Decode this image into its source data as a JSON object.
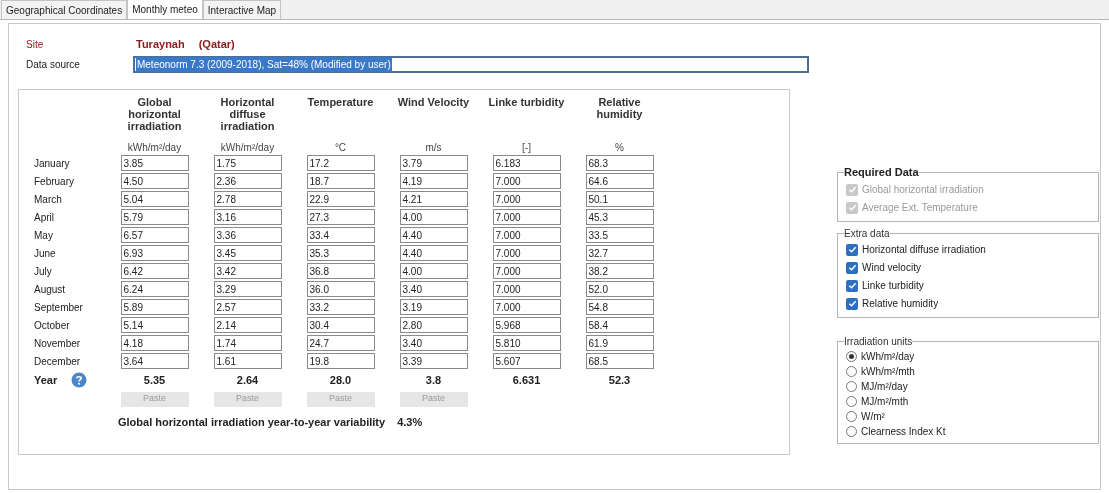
{
  "tabs": [
    {
      "label": "Geographical Coordinates",
      "selected": false
    },
    {
      "label": "Monthly meteo",
      "selected": true
    },
    {
      "label": "Interactive Map",
      "selected": false
    }
  ],
  "site": {
    "label": "Site",
    "name": "Turaynah",
    "country": "(Qatar)"
  },
  "data_source": {
    "label": "Data source",
    "value": "Meteonorm 7.3 (2009-2018), Sat=48% (Modified by user)"
  },
  "table": {
    "columns": [
      {
        "title": "Global horizontal irradiation",
        "unit": "kWh/m²/day",
        "year": "5.35",
        "paste": "Paste"
      },
      {
        "title": "Horizontal diffuse irradiation",
        "unit": "kWh/m²/day",
        "year": "2.64",
        "paste": "Paste"
      },
      {
        "title": "Temperature",
        "unit": "°C",
        "year": "28.0",
        "paste": "Paste"
      },
      {
        "title": "Wind Velocity",
        "unit": "m/s",
        "year": "3.8",
        "paste": "Paste"
      },
      {
        "title": "Linke turbidity",
        "unit": "[-]",
        "year": "6.631"
      },
      {
        "title": "Relative humidity",
        "unit": "%",
        "year": "52.3"
      }
    ],
    "rows": [
      {
        "month": "January",
        "values": [
          "3.85",
          "1.75",
          "17.2",
          "3.79",
          "6.183",
          "68.3"
        ]
      },
      {
        "month": "February",
        "values": [
          "4.50",
          "2.36",
          "18.7",
          "4.19",
          "7.000",
          "64.6"
        ]
      },
      {
        "month": "March",
        "values": [
          "5.04",
          "2.78",
          "22.9",
          "4.21",
          "7.000",
          "50.1"
        ]
      },
      {
        "month": "April",
        "values": [
          "5.79",
          "3.16",
          "27.3",
          "4.00",
          "7.000",
          "45.3"
        ]
      },
      {
        "month": "May",
        "values": [
          "6.57",
          "3.36",
          "33.4",
          "4.40",
          "7.000",
          "33.5"
        ]
      },
      {
        "month": "June",
        "values": [
          "6.93",
          "3.45",
          "35.3",
          "4.40",
          "7.000",
          "32.7"
        ]
      },
      {
        "month": "July",
        "values": [
          "6.42",
          "3.42",
          "36.8",
          "4.00",
          "7.000",
          "38.2"
        ]
      },
      {
        "month": "August",
        "values": [
          "6.24",
          "3.29",
          "36.0",
          "3.40",
          "7.000",
          "52.0"
        ]
      },
      {
        "month": "September",
        "values": [
          "5.89",
          "2.57",
          "33.2",
          "3.19",
          "7.000",
          "54.8"
        ]
      },
      {
        "month": "October",
        "values": [
          "5.14",
          "2.14",
          "30.4",
          "2.80",
          "5.968",
          "58.4"
        ]
      },
      {
        "month": "November",
        "values": [
          "4.18",
          "1.74",
          "24.7",
          "3.40",
          "5.810",
          "61.9"
        ]
      },
      {
        "month": "December",
        "values": [
          "3.64",
          "1.61",
          "19.8",
          "3.39",
          "5.607",
          "68.5"
        ]
      }
    ],
    "year_label": "Year",
    "variability": {
      "label": "Global horizontal irradiation year-to-year variability",
      "value": "4.3%"
    }
  },
  "required_data": {
    "title": "Required Data",
    "items": [
      {
        "label": "Global horizontal irradiation",
        "checked": true,
        "disabled": true
      },
      {
        "label": "Average Ext. Temperature",
        "checked": true,
        "disabled": true
      }
    ]
  },
  "extra_data": {
    "title": "Extra data",
    "items": [
      {
        "label": "Horizontal diffuse irradiation",
        "checked": true,
        "disabled": false
      },
      {
        "label": "Wind velocity",
        "checked": true,
        "disabled": false
      },
      {
        "label": "Linke turbidity",
        "checked": true,
        "disabled": false
      },
      {
        "label": "Relative humidity",
        "checked": true,
        "disabled": false
      }
    ]
  },
  "irradiation_units": {
    "title": "Irradiation units",
    "options": [
      {
        "label": "kWh/m²/day",
        "selected": true
      },
      {
        "label": "kWh/m²/mth",
        "selected": false
      },
      {
        "label": "MJ/m²/day",
        "selected": false
      },
      {
        "label": "MJ/m²/mth",
        "selected": false
      },
      {
        "label": "W/m²",
        "selected": false
      },
      {
        "label": "Clearness Index Kt",
        "selected": false
      }
    ]
  }
}
